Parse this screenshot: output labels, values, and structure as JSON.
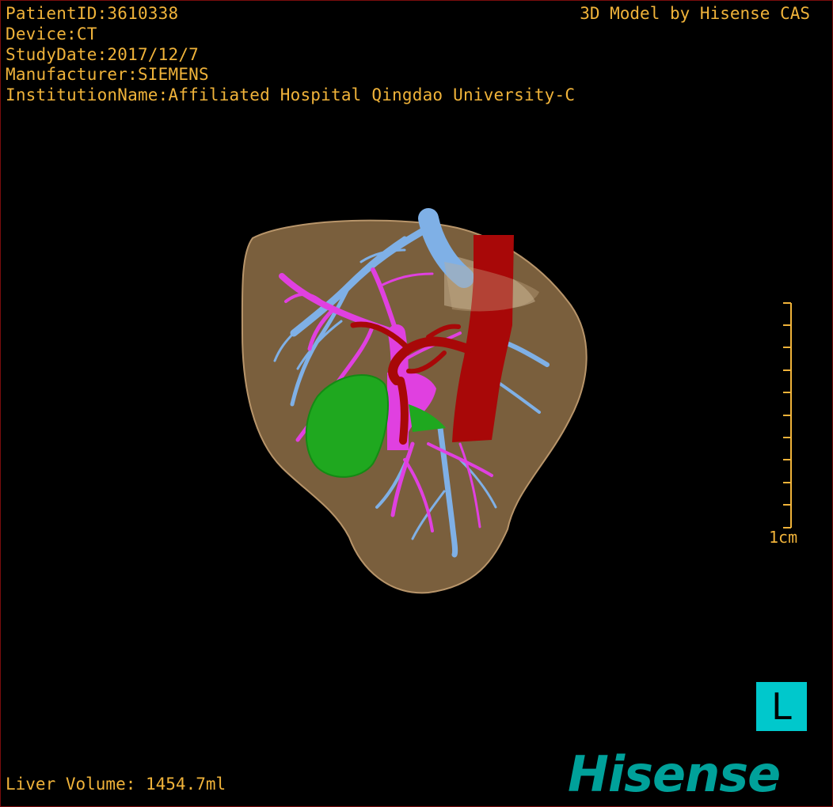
{
  "patient": {
    "patient_id": "PatientID:3610338",
    "device": "Device:CT",
    "study_date": "StudyDate:2017/12/7",
    "manufacturer": "Manufacturer:SIEMENS",
    "institution": "InstitutionName:Affiliated Hospital Qingdao University-C"
  },
  "credit": "3D Model by Hisense CAS",
  "liver_volume": "Liver Volume: 1454.7ml",
  "scale_bar": {
    "label": "1cm"
  },
  "orientation_marker": "L",
  "brand_logo": "Hisense",
  "colors": {
    "text": "#f0b33a",
    "liver": "#9c7a4e",
    "hepatic_vein": "#7fb0e6",
    "portal_vein": "#e040e0",
    "artery": "#a80808",
    "gallbladder": "#1fa81f",
    "orientation_bg": "#00c8cc",
    "brand": "#00a19a",
    "border": "#7a0d0d"
  }
}
